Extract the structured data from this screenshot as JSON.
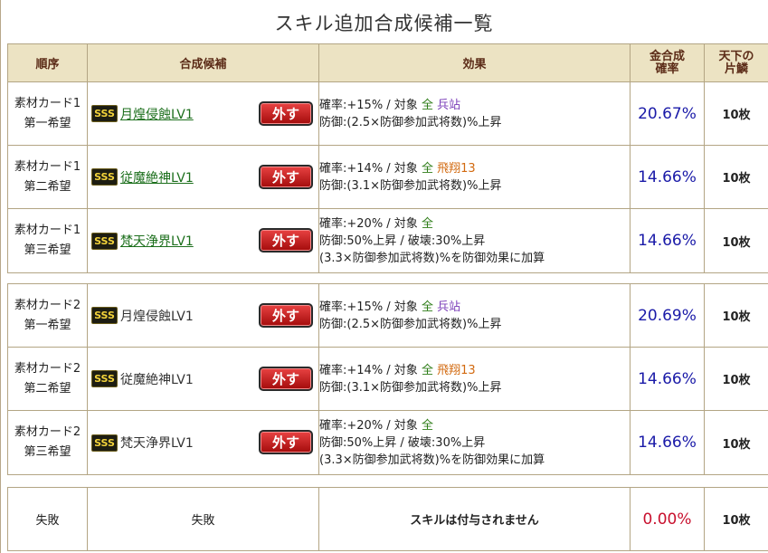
{
  "title": "スキル追加合成候補一覧",
  "remove_label": "外す",
  "sss_label": "SSS",
  "headers": {
    "order": "順序",
    "candidate": "合成候補",
    "effect": "効果",
    "rate_line1": "金合成",
    "rate_line2": "確率",
    "tenka_line1": "天下の",
    "tenka_line2": "片鱗"
  },
  "rows": [
    {
      "card": "素材カード1",
      "pref": "第一希望",
      "skill": "月煌侵蝕LV1",
      "eff1": {
        "rate": "確率:+15%  /  対象",
        "zen": "全",
        "target": "兵站",
        "tcolor": "hei"
      },
      "eff2": "防御:(2.5×防御参加武将数)%上昇",
      "eff3": "",
      "percent": "20.67%",
      "count": "10枚"
    },
    {
      "card": "素材カード1",
      "pref": "第二希望",
      "skill": "従魔絶神LV1",
      "eff1": {
        "rate": "確率:+14%  /  対象",
        "zen": "全",
        "target": "飛翔13",
        "tcolor": "hi"
      },
      "eff2": "防御:(3.1×防御参加武将数)%上昇",
      "eff3": "",
      "percent": "14.66%",
      "count": "10枚"
    },
    {
      "card": "素材カード1",
      "pref": "第三希望",
      "skill": "梵天浄界LV1",
      "eff1": {
        "rate": "確率:+20%  /  対象",
        "zen": "全",
        "target": "",
        "tcolor": ""
      },
      "eff2": "防御:50%上昇  /  破壊:30%上昇",
      "eff3": "(3.3×防御参加武将数)%を防御効果に加算",
      "percent": "14.66%",
      "count": "10枚"
    },
    {
      "card": "素材カード2",
      "pref": "第一希望",
      "skill": "月煌侵蝕LV1",
      "eff1": {
        "rate": "確率:+15%  /  対象",
        "zen": "全",
        "target": "兵站",
        "tcolor": "hei"
      },
      "eff2": "防御:(2.5×防御参加武将数)%上昇",
      "eff3": "",
      "percent": "20.69%",
      "count": "10枚"
    },
    {
      "card": "素材カード2",
      "pref": "第二希望",
      "skill": "従魔絶神LV1",
      "eff1": {
        "rate": "確率:+14%  /  対象",
        "zen": "全",
        "target": "飛翔13",
        "tcolor": "hi"
      },
      "eff2": "防御:(3.1×防御参加武将数)%上昇",
      "eff3": "",
      "percent": "14.66%",
      "count": "10枚"
    },
    {
      "card": "素材カード2",
      "pref": "第三希望",
      "skill": "梵天浄界LV1",
      "eff1": {
        "rate": "確率:+20%  /  対象",
        "zen": "全",
        "target": "",
        "tcolor": ""
      },
      "eff2": "防御:50%上昇  /  破壊:30%上昇",
      "eff3": "(3.3×防御参加武将数)%を防御効果に加算",
      "percent": "14.66%",
      "count": "10枚"
    }
  ],
  "fail": {
    "order": "失敗",
    "candidate": "失敗",
    "effect": "スキルは付与されません",
    "percent": "0.00%",
    "count": "10枚"
  }
}
